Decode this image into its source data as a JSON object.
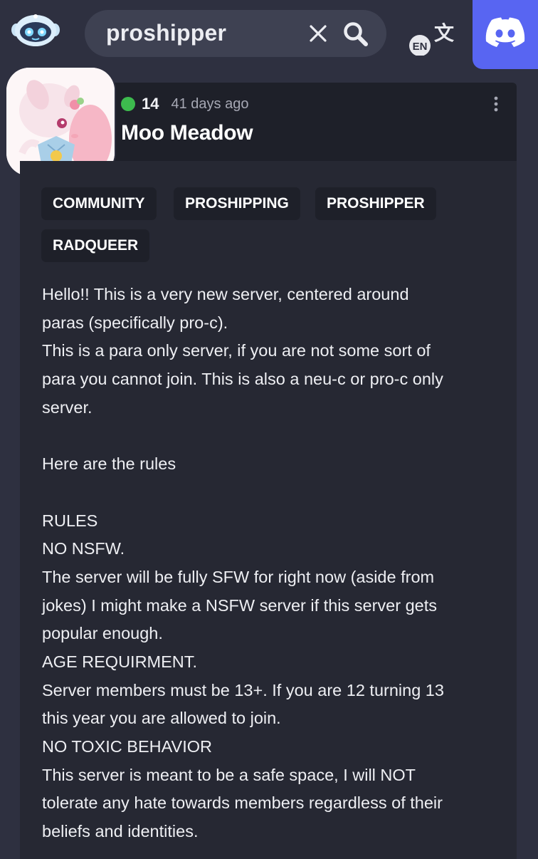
{
  "search": {
    "query": "proshipper"
  },
  "translate": {
    "badge": "EN"
  },
  "post": {
    "level": "14",
    "time_ago": "41 days ago",
    "title": "Moo Meadow",
    "tags": [
      "COMMUNITY",
      "PROSHIPPING",
      "PROSHIPPER",
      "RADQUEER"
    ],
    "content_lines": [
      "Hello!! This is a very new server, centered around",
      "paras (specifically pro-c).",
      "This is a para only server, if you are not some sort of",
      "para you cannot join. This is also a neu-c or pro-c only",
      "server.",
      "",
      "Here are the rules",
      "",
      "RULES",
      "NO NSFW.",
      "The server will be fully SFW for right now (aside from",
      "jokes) I might make a NSFW server if this server gets",
      "popular enough.",
      "AGE REQUIRMENT.",
      "Server members must be 13+. If you are 12 turning 13",
      "this year you are allowed to join.",
      "NO TOXIC BEHAVIOR",
      "This server is meant to be a safe space, I will NOT",
      "tolerate any hate towards members regardless of their",
      "beliefs and identities."
    ]
  },
  "colors": {
    "background": "#2e3040",
    "discord": "#5865f2",
    "online": "#3dbb4e"
  }
}
